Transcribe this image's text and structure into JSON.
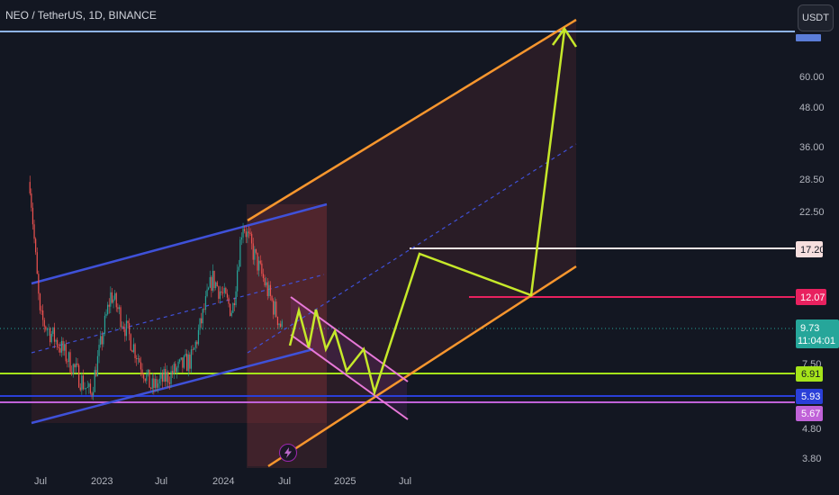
{
  "header": {
    "title": "NEO / TetherUS, 1D, BINANCE",
    "currency_button": "USDT"
  },
  "colors": {
    "background": "#131722",
    "candle_up": "#26a69a",
    "candle_down": "#ef5350",
    "channel_blue": "#3f51d9",
    "channel_orange": "#f7962e",
    "zigzag": "#c6e82a",
    "green_level": "#a5e41a",
    "pink_level": "#e8215f",
    "white_level": "#f3e3e3",
    "purple_level": "#c062d8",
    "blue_level": "#2a3fd8",
    "top_level": "#8fb4e8"
  },
  "icons": {
    "replay": "lightning-bolt-icon"
  },
  "chart_data": {
    "type": "candlestick",
    "symbol": "NEO / TetherUS",
    "interval": "1D",
    "exchange": "BINANCE",
    "y_scale": "log",
    "y_tick_labels": [
      "60.00",
      "48.00",
      "36.00",
      "28.50",
      "22.50",
      "7.50",
      "4.80",
      "3.80"
    ],
    "x_tick_labels": [
      "Jul",
      "2023",
      "Jul",
      "2024",
      "Jul",
      "2025",
      "Jul"
    ],
    "price_labels": [
      {
        "value": "17.20",
        "role": "resistance"
      },
      {
        "value": "12.07",
        "role": "level"
      },
      {
        "value": "9.73",
        "role": "last-price"
      },
      {
        "value": "11:04:01",
        "role": "bar-countdown"
      },
      {
        "value": "6.91",
        "role": "support"
      },
      {
        "value": "5.93",
        "role": "support"
      },
      {
        "value": "5.67",
        "role": "support"
      }
    ],
    "series": [
      {
        "name": "NEO/USDT",
        "approx_closes": [
          {
            "date": "2022-06",
            "close": 28
          },
          {
            "date": "2022-07",
            "close": 10.5
          },
          {
            "date": "2022-09",
            "close": 8.5
          },
          {
            "date": "2022-12",
            "close": 6.0
          },
          {
            "date": "2023-02",
            "close": 12.5
          },
          {
            "date": "2023-06",
            "close": 6.3
          },
          {
            "date": "2023-10",
            "close": 7.8
          },
          {
            "date": "2023-12",
            "close": 14.0
          },
          {
            "date": "2024-02",
            "close": 11.0
          },
          {
            "date": "2024-03",
            "close": 21.0
          },
          {
            "date": "2024-04",
            "close": 17.0
          },
          {
            "date": "2024-06",
            "close": 11.5
          },
          {
            "date": "2024-07",
            "close": 9.5
          }
        ]
      }
    ],
    "annotations": [
      "rising blue channel",
      "descending pink channel",
      "rising orange channel",
      "projected zigzag path"
    ]
  }
}
